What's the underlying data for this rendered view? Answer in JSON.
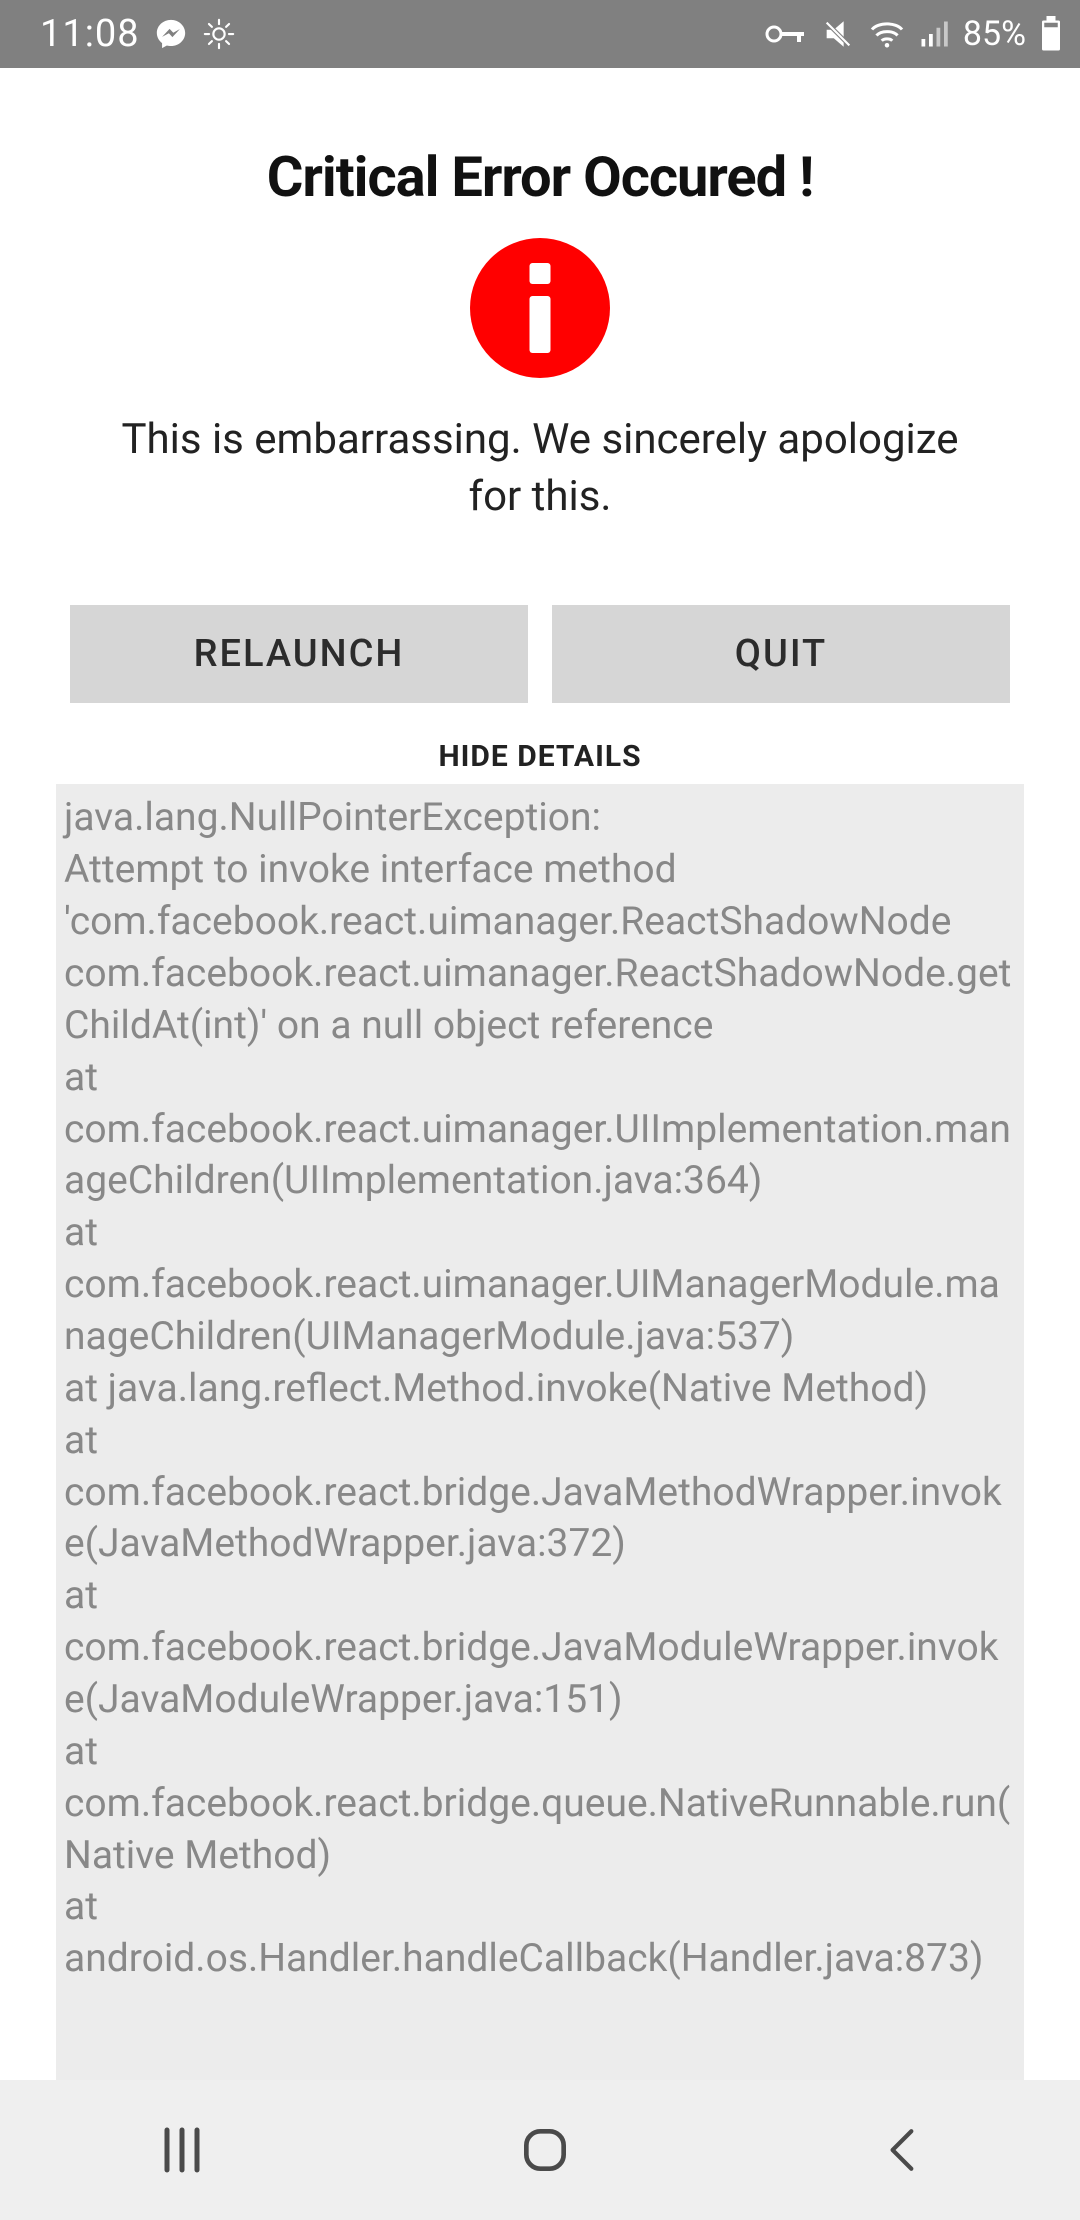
{
  "statusbar": {
    "time": "11:08",
    "battery_text": "85%"
  },
  "error": {
    "title": "Critical Error Occured !",
    "apology": "This is embarrassing. We sincerely apologize for this.",
    "relaunch_label": "RELAUNCH",
    "quit_label": "QUIT",
    "details_toggle": "HIDE DETAILS",
    "stack": [
      "java.lang.NullPointerException:",
      "Attempt to invoke interface method 'com.facebook.react.uimanager.ReactShadowNode com.facebook.react.uimanager.ReactShadowNode.getChildAt(int)' on a null object reference",
      "  at com.facebook.react.uimanager.UIImplementation.manageChildren(UIImplementation.java:364)",
      "  at com.facebook.react.uimanager.UIManagerModule.manageChildren(UIManagerModule.java:537)",
      "  at java.lang.reflect.Method.invoke(Native Method)",
      "  at com.facebook.react.bridge.JavaMethodWrapper.invoke(JavaMethodWrapper.java:372)",
      "  at com.facebook.react.bridge.JavaModuleWrapper.invoke(JavaModuleWrapper.java:151)",
      "  at com.facebook.react.bridge.queue.NativeRunnable.run(Native Method)",
      "  at android.os.Handler.handleCallback(Handler.java:873)"
    ]
  }
}
